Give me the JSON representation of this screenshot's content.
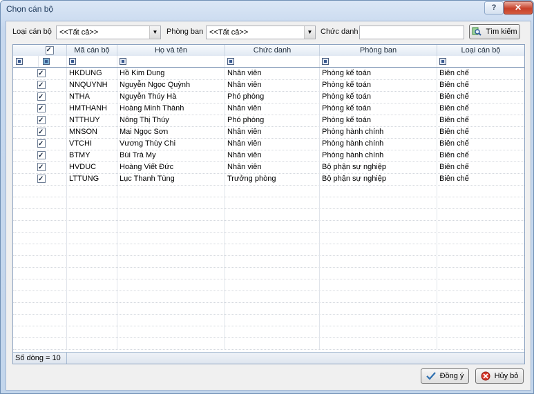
{
  "window": {
    "title": "Chọn cán bộ",
    "help": "?",
    "close": "✕"
  },
  "filters": {
    "loai_can_bo_label": "Loại cán bộ",
    "loai_can_bo_value": "<<Tất cả>>",
    "phong_ban_label": "Phòng ban",
    "phong_ban_value": "<<Tất cả>>",
    "chuc_danh_label": "Chức danh",
    "chuc_danh_value": "",
    "search_button": "Tìm kiếm"
  },
  "grid": {
    "columns": [
      "Mã cán bộ",
      "Họ và tên",
      "Chức danh",
      "Phòng ban",
      "Loại cán bộ"
    ],
    "rows": [
      {
        "checked": true,
        "ma": "HKDUNG",
        "ten": "Hồ Kim Dung",
        "chuc_danh": "Nhân viên",
        "phong_ban": "Phòng kế toán",
        "loai": "Biên chế"
      },
      {
        "checked": true,
        "ma": "NNQUYNH",
        "ten": "Nguyễn Ngọc Quỳnh",
        "chuc_danh": "Nhân viên",
        "phong_ban": "Phòng kế toán",
        "loai": "Biên chế"
      },
      {
        "checked": true,
        "ma": "NTHA",
        "ten": "Nguyễn Thúy Hà",
        "chuc_danh": "Phó phòng",
        "phong_ban": "Phòng kế toán",
        "loai": "Biên chế"
      },
      {
        "checked": true,
        "ma": "HMTHANH",
        "ten": "Hoàng Minh Thành",
        "chuc_danh": "Nhân viên",
        "phong_ban": "Phòng kế toán",
        "loai": "Biên chế"
      },
      {
        "checked": true,
        "ma": "NTTHUY",
        "ten": "Nông Thị Thúy",
        "chuc_danh": "Phó phòng",
        "phong_ban": "Phòng kế toán",
        "loai": "Biên chế"
      },
      {
        "checked": true,
        "ma": "MNSON",
        "ten": "Mai Ngọc Sơn",
        "chuc_danh": "Nhân viên",
        "phong_ban": "Phòng hành chính",
        "loai": "Biên chế"
      },
      {
        "checked": true,
        "ma": "VTCHI",
        "ten": "Vương Thùy Chi",
        "chuc_danh": "Nhân viên",
        "phong_ban": "Phòng hành chính",
        "loai": "Biên chế"
      },
      {
        "checked": true,
        "ma": "BTMY",
        "ten": "Bùi Trà My",
        "chuc_danh": "Nhân viên",
        "phong_ban": "Phòng hành chính",
        "loai": "Biên chế"
      },
      {
        "checked": true,
        "ma": "HVDUC",
        "ten": "Hoàng Viết Đức",
        "chuc_danh": "Nhân viên",
        "phong_ban": "Bộ phận sự nghiệp",
        "loai": "Biên chế"
      },
      {
        "checked": true,
        "ma": "LTTUNG",
        "ten": "Lục Thanh Tùng",
        "chuc_danh": "Trưởng phòng",
        "phong_ban": "Bộ phận sự nghiệp",
        "loai": "Biên chế"
      }
    ],
    "footer": "Số dòng = 10"
  },
  "buttons": {
    "ok": "Đồng ý",
    "cancel": "Hủy bỏ"
  },
  "colors": {
    "titlebar": "#c7d8ee",
    "close": "#c7402a",
    "grid_border": "#8ca2c0"
  }
}
